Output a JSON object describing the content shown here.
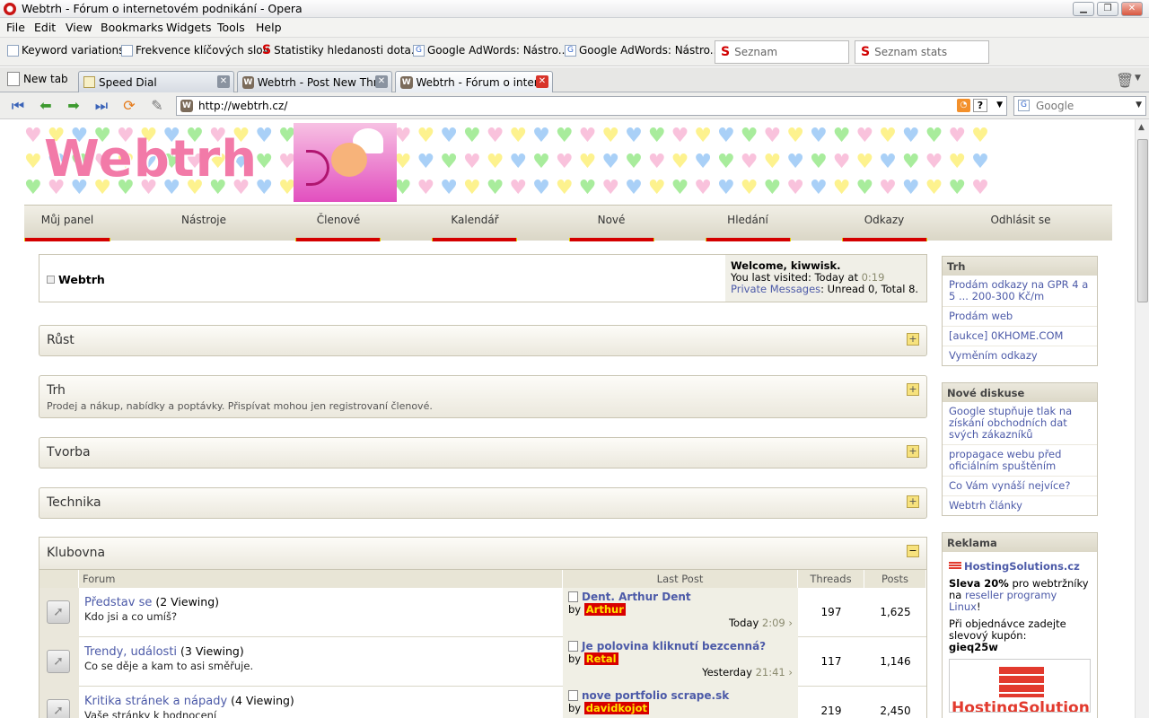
{
  "window": {
    "title": "Webtrh - Fórum o internetovém podnikání - Opera"
  },
  "menu": [
    "File",
    "Edit",
    "View",
    "Bookmarks",
    "Widgets",
    "Tools",
    "Help"
  ],
  "bookmarks": [
    {
      "label": "Keyword variations",
      "icon": "page-icon"
    },
    {
      "label": "Frekvence klíčových slov",
      "icon": "page-icon"
    },
    {
      "label": "Statistiky hledanosti dota...",
      "icon": "seznam-icon"
    },
    {
      "label": "Google AdWords: Nástro...",
      "icon": "google-icon"
    },
    {
      "label": "Google AdWords: Nástro...",
      "icon": "google-icon"
    }
  ],
  "bookmark_boxes": [
    "Seznam",
    "Seznam stats"
  ],
  "tabs": [
    {
      "label": "New tab"
    },
    {
      "label": "Speed Dial"
    },
    {
      "label": "Webtrh - Post New Thr..."
    },
    {
      "label": "Webtrh - Fórum o inter..."
    }
  ],
  "address": {
    "url": "http://webtrh.cz/",
    "search_placeholder": "Google"
  },
  "site": {
    "logo": "Webtrh",
    "nav": [
      "Můj panel",
      "Nástroje",
      "Členové",
      "Kalendář",
      "Nové",
      "Hledání",
      "Odkazy",
      "Odhlásit se"
    ]
  },
  "welcome": {
    "title": "Webtrh",
    "greeting": "Welcome, kiwwisk.",
    "last_visited_label": "You last visited: Today at",
    "last_visited_time": "0:19",
    "pm_link": "Private Messages",
    "pm_text": ": Unread 0, Total 8."
  },
  "categories": [
    {
      "name": "Růst",
      "desc": ""
    },
    {
      "name": "Trh",
      "desc": "Prodej a nákup, nabídky a poptávky. Přispívat mohou jen registrovaní členové."
    },
    {
      "name": "Tvorba",
      "desc": ""
    },
    {
      "name": "Technika",
      "desc": ""
    }
  ],
  "club": {
    "name": "Klubovna",
    "headers": {
      "forum": "Forum",
      "last_post": "Last Post",
      "threads": "Threads",
      "posts": "Posts"
    },
    "rows": [
      {
        "name": "Představ se",
        "viewing": "(2 Viewing)",
        "desc": "Kdo jsi a co umíš?",
        "lp_title": "Dent. Arthur Dent",
        "by": "by",
        "lp_user": "Arthur",
        "lp_day": "Today",
        "lp_time": "2:09",
        "threads": "197",
        "posts": "1,625"
      },
      {
        "name": "Trendy, události",
        "viewing": "(3 Viewing)",
        "desc": "Co se děje a kam to asi směřuje.",
        "lp_title": "Je polovina kliknutí bezcenná?",
        "by": "by",
        "lp_user": "Retal",
        "lp_day": "Yesterday",
        "lp_time": "21:41",
        "threads": "117",
        "posts": "1,146"
      },
      {
        "name": "Kritika stránek a nápady",
        "viewing": "(4 Viewing)",
        "desc": "Vaše stránky k hodnocení",
        "lp_title": "nove portfolio scrape.sk",
        "by": "by",
        "lp_user": "davidkojot",
        "lp_day": "",
        "lp_time": "",
        "threads": "219",
        "posts": "2,450"
      }
    ]
  },
  "sidebar": {
    "trh": {
      "title": "Trh",
      "items": [
        "Prodám odkazy na GPR 4 a 5 ... 200-300 Kč/m",
        "Prodám web",
        "[aukce] 0KHOME.COM",
        "Vyměním odkazy"
      ]
    },
    "nove": {
      "title": "Nové diskuse",
      "items": [
        "Google stupňuje tlak na získání obchodních dat svých zákazníků",
        "propagace webu před oficiálním spuštěním",
        "Co Vám vynáší nejvíce?",
        "Webtrh články"
      ]
    },
    "reklama": {
      "title": "Reklama",
      "brand": "HostingSolutions.cz",
      "line1_bold": "Sleva 20%",
      "line1_rest": " pro webtržníky",
      "line2_pre": "na ",
      "line2_link": "reseller programy Linux",
      "line2_post": "!",
      "line3": "Při objednávce zadejte slevový kupón:",
      "coupon": "gieq25w",
      "banner_text": "HostingSolutions"
    }
  },
  "colors": {
    "accent_red": "#d40000",
    "link": "#4c5aa8",
    "nav_bg": "#dad6c6"
  }
}
